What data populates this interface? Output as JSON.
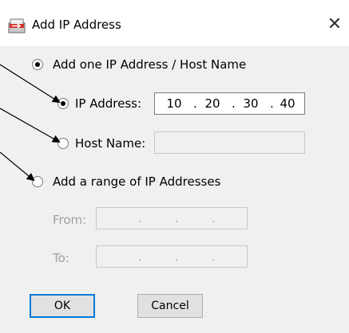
{
  "dialog": {
    "title": "Add IP Address"
  },
  "icons": {
    "app": "add-ip-icon",
    "close": "close-icon"
  },
  "options": {
    "add_one_label": "Add one IP Address / Host Name",
    "ip_address_label": "IP Address:",
    "host_name_label": "Host Name:",
    "add_range_label": "Add a range of IP Addresses",
    "from_label": "From:",
    "to_label": "To:"
  },
  "values": {
    "ip_octets": [
      "10",
      "20",
      "30",
      "40"
    ],
    "host_name": ""
  },
  "buttons": {
    "ok": "OK",
    "cancel": "Cancel"
  },
  "colors": {
    "accent": "#0078d7",
    "icon_red": "#d9302a"
  }
}
